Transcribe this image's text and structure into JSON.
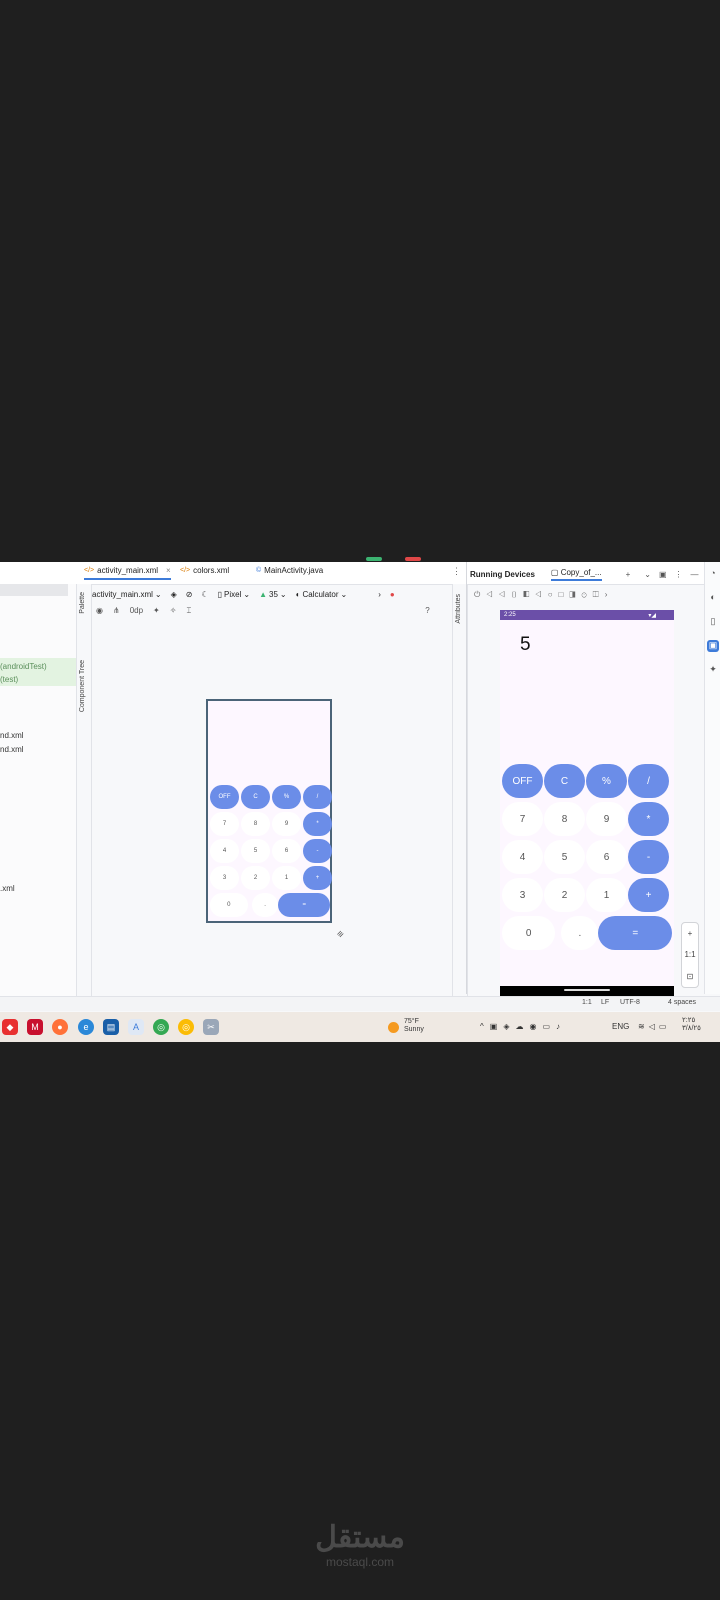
{
  "tabs": [
    {
      "label": "activity_main.xml",
      "active": true
    },
    {
      "label": "colors.xml"
    },
    {
      "label": "MainActivity.java"
    }
  ],
  "left_panel": {
    "items": [
      "(androidTest)",
      "(test)",
      "nd.xml",
      "nd.xml",
      ".xml"
    ]
  },
  "side_labels": {
    "palette": "Palette",
    "component_tree": "Component Tree",
    "attributes": "Attributes"
  },
  "toolbar": {
    "file": "activity_main.xml",
    "device": "Pixel",
    "api": "35",
    "theme": "Calculator"
  },
  "toolbar2": {
    "dp": "0dp"
  },
  "running_devices": {
    "title": "Running Devices",
    "device_tab": "Copy_of_..."
  },
  "device": {
    "status_time": "2:25",
    "display": "5"
  },
  "calculator": {
    "rows": [
      [
        {
          "t": "OFF",
          "s": "blue"
        },
        {
          "t": "C",
          "s": "blue"
        },
        {
          "t": "%",
          "s": "blue"
        },
        {
          "t": "/",
          "s": "blue"
        }
      ],
      [
        {
          "t": "7",
          "s": "white"
        },
        {
          "t": "8",
          "s": "white"
        },
        {
          "t": "9",
          "s": "white"
        },
        {
          "t": "*",
          "s": "blue"
        }
      ],
      [
        {
          "t": "4",
          "s": "white"
        },
        {
          "t": "5",
          "s": "white"
        },
        {
          "t": "6",
          "s": "white"
        },
        {
          "t": "-",
          "s": "blue"
        }
      ],
      [
        {
          "t": "3",
          "s": "white"
        },
        {
          "t": "2",
          "s": "white"
        },
        {
          "t": "1",
          "s": "white"
        },
        {
          "t": "+",
          "s": "blue"
        }
      ]
    ],
    "bottom": [
      {
        "t": "0",
        "s": "white"
      },
      {
        "t": ".",
        "s": "white"
      },
      {
        "t": "=",
        "s": "blue"
      }
    ]
  },
  "zoom": {
    "plus": "+",
    "ratio": "1:1"
  },
  "statusbar": {
    "pos": "1:1",
    "le": "LF",
    "enc": "UTF-8",
    "indent": "4 spaces"
  },
  "taskbar": {
    "temp": "75°F",
    "condition": "Sunny",
    "lang": "ENG",
    "time": "٢:٢٥",
    "date": "٣/٨/٢٥"
  },
  "watermark": {
    "brand": "مستقل",
    "site": "mostaql.com"
  },
  "colors": {
    "accent": "#6b8de8",
    "device_bg": "#fdf7ff",
    "status": "#6b4fa8"
  }
}
